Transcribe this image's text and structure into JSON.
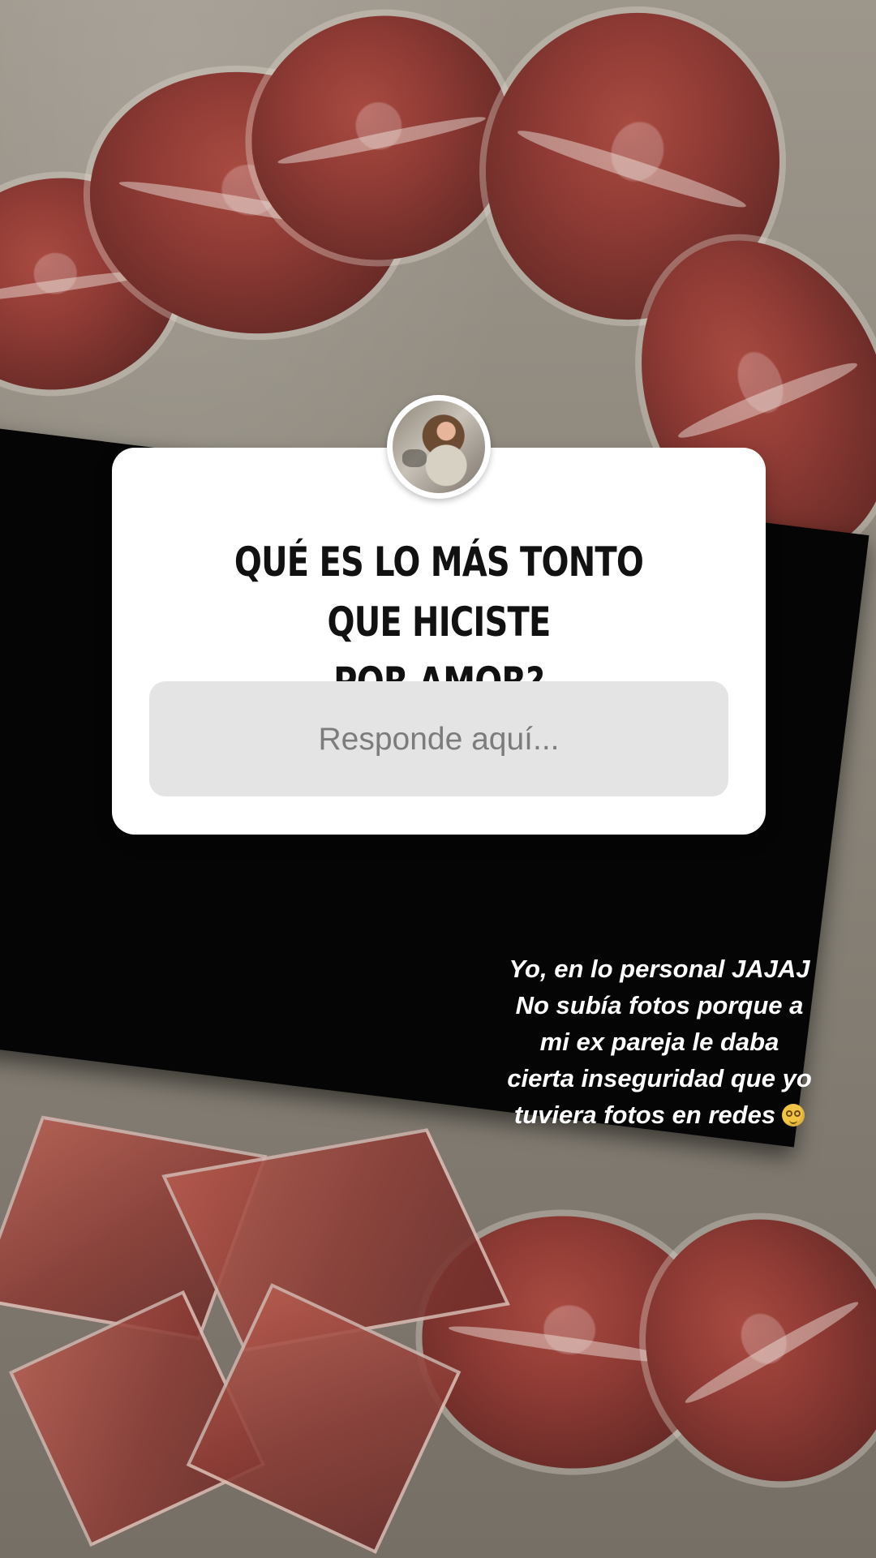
{
  "story": {
    "question_sticker": {
      "avatar_icon": "profile-photo-icon",
      "question_line_1": "QUÉ ES LO MÁS TONTO QUE HICISTE",
      "question_line_2": "POR AMOR?",
      "reply_placeholder": "Responde aquí..."
    },
    "caption": {
      "line_1": "Yo, en lo personal JAJAJ",
      "line_2": "No subía fotos porque a",
      "line_3": "mi ex pareja le daba",
      "line_4": "cierta inseguridad que yo",
      "line_5": "tuviera fotos en redes",
      "emoji_icon": "woozy-face-emoji-icon"
    }
  },
  "colors": {
    "card_background": "#ffffff",
    "reply_background": "#e4e4e4",
    "question_text": "#111111",
    "placeholder_text": "#7c7c7c",
    "caption_text": "#ffffff"
  }
}
